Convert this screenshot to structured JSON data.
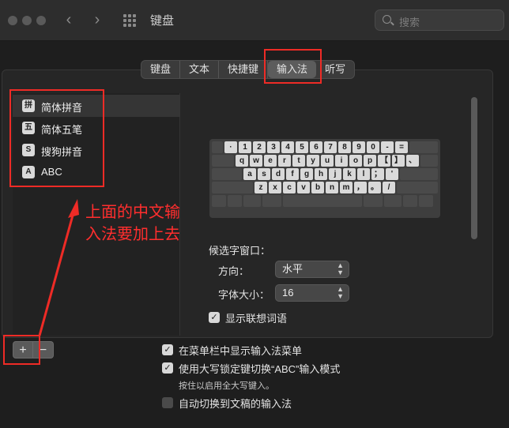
{
  "window": {
    "title": "键盘",
    "search_placeholder": "搜索"
  },
  "tabs": [
    {
      "label": "键盘",
      "selected": false
    },
    {
      "label": "文本",
      "selected": false
    },
    {
      "label": "快捷键",
      "selected": false
    },
    {
      "label": "输入法",
      "selected": true
    },
    {
      "label": "听写",
      "selected": false
    }
  ],
  "input_sources": [
    {
      "icon_text": "拼",
      "label": "简体拼音",
      "selected": true
    },
    {
      "icon_text": "五",
      "label": "简体五笔",
      "selected": false
    },
    {
      "icon_text": "S",
      "label": "搜狗拼音",
      "selected": false
    },
    {
      "icon_text": "A",
      "label": "ABC",
      "selected": false
    }
  ],
  "keyboard": {
    "rows": [
      [
        "·",
        "1",
        "2",
        "3",
        "4",
        "5",
        "6",
        "7",
        "8",
        "9",
        "0",
        "-",
        "="
      ],
      [
        "q",
        "w",
        "e",
        "r",
        "t",
        "y",
        "u",
        "i",
        "o",
        "p",
        "【",
        "】",
        "、"
      ],
      [
        "a",
        "s",
        "d",
        "f",
        "g",
        "h",
        "j",
        "k",
        "l",
        "；",
        "'"
      ],
      [
        "z",
        "x",
        "c",
        "v",
        "b",
        "n",
        "m",
        "，",
        "。",
        "/"
      ]
    ]
  },
  "candidate_window": {
    "heading": "候选字窗口：",
    "direction_label": "方向：",
    "direction_value": "水平",
    "font_size_label": "字体大小：",
    "font_size_value": "16",
    "show_predictions_label": "显示联想词语",
    "show_predictions_checked": true
  },
  "options": {
    "show_menu_label": "在菜单栏中显示输入法菜单",
    "show_menu_checked": true,
    "capslock_label": "使用大写锁定键切换“ABC”输入模式",
    "capslock_checked": true,
    "capslock_hint": "按住以启用全大写键入。",
    "auto_switch_label": "自动切换到文稿的输入法",
    "auto_switch_checked": false
  },
  "buttons": {
    "add": "+",
    "remove": "−"
  },
  "annotation": {
    "text": "上面的中文输入法要加上去",
    "color": "#ff2e2e"
  }
}
